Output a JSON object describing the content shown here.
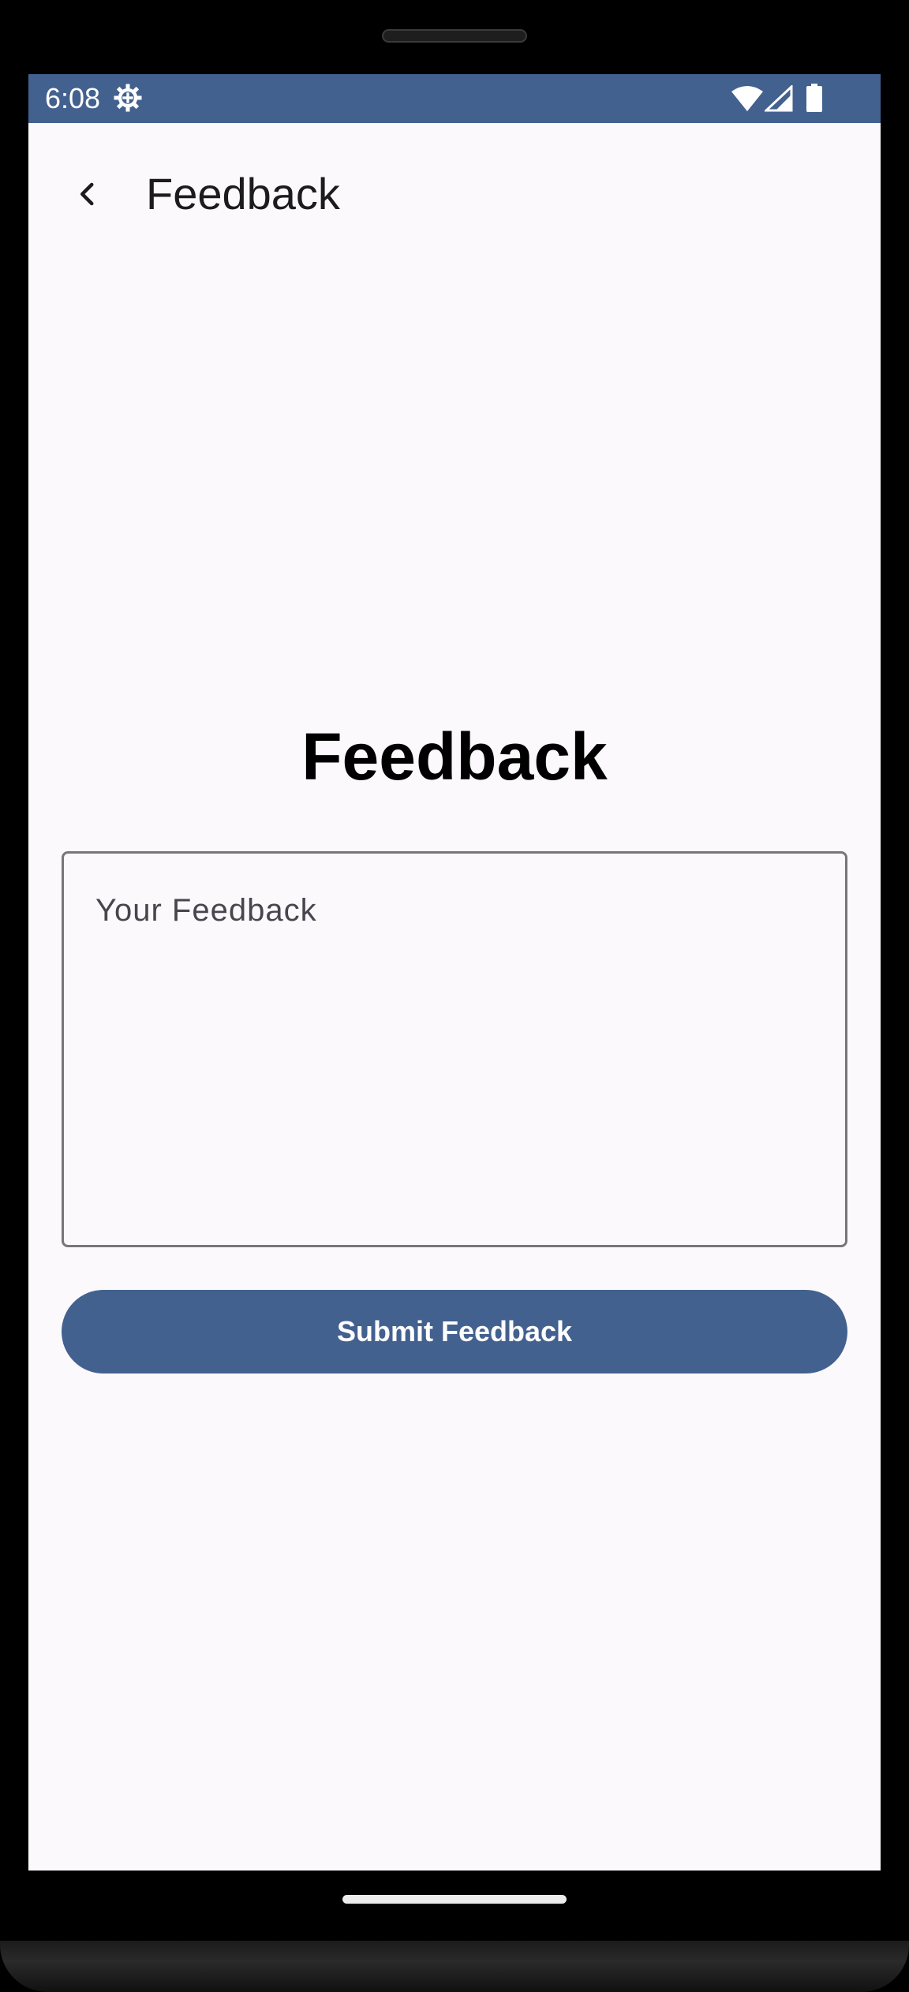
{
  "status_bar": {
    "time": "6:08",
    "icons": [
      "gear-icon",
      "wifi-icon",
      "signal-icon",
      "battery-icon"
    ],
    "background": "#43618f"
  },
  "app_bar": {
    "back_icon": "chevron-left-icon",
    "title": "Feedback"
  },
  "main": {
    "heading": "Feedback",
    "feedback_input": {
      "value": "",
      "placeholder": "Your Feedback"
    },
    "submit_label": "Submit Feedback"
  },
  "colors": {
    "primary": "#43618f",
    "screen_background": "#fcf9fc",
    "outline": "#77767a"
  }
}
